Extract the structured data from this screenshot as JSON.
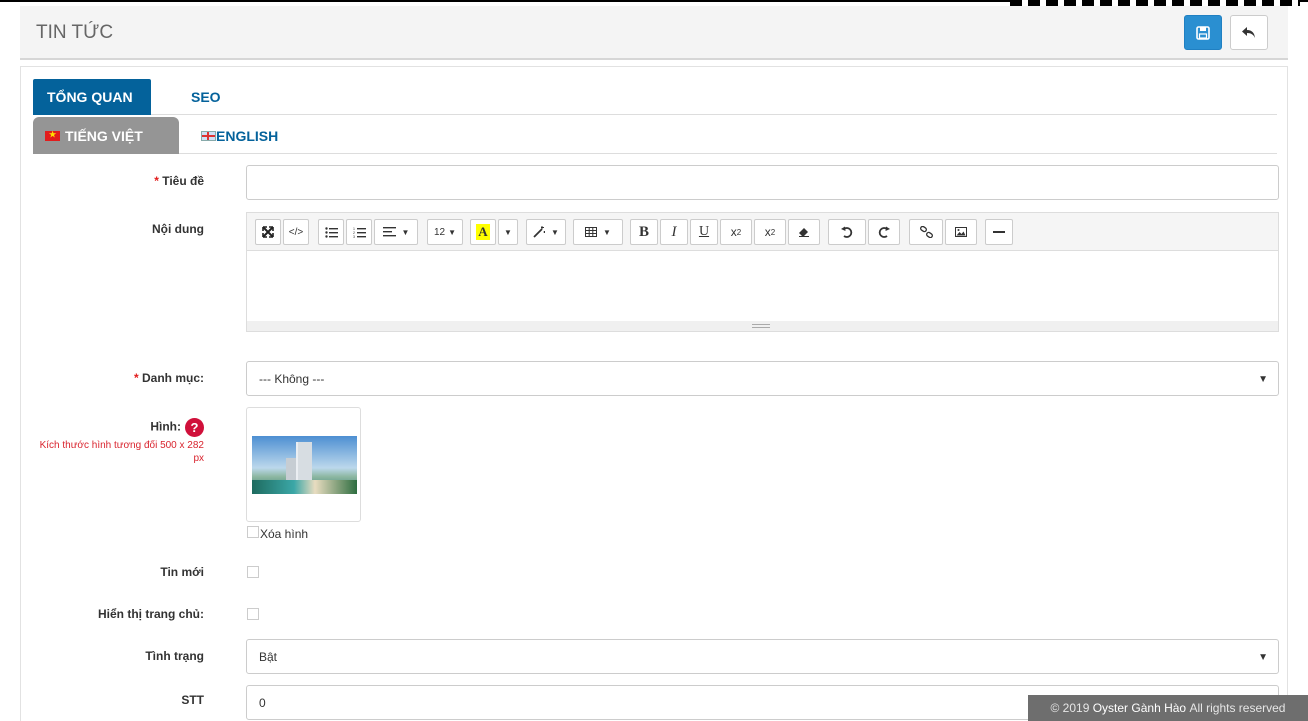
{
  "header": {
    "title": "TIN TỨC"
  },
  "tabs": [
    {
      "label": "TỔNG QUAN",
      "active": true
    },
    {
      "label": "SEO",
      "active": false
    }
  ],
  "lang_tabs": [
    {
      "label": "TIẾNG VIỆT",
      "flag": "vietnam-flag-icon",
      "active": true
    },
    {
      "label": "ENGLISH",
      "flag": "uk-flag-icon",
      "active": false
    }
  ],
  "form": {
    "title_label": "Tiêu đề",
    "title_value": "",
    "content_label": "Nội dung",
    "category_label": "Danh mục:",
    "category_value": "--- Không ---",
    "image_label": "Hình:",
    "image_hint": "Kích thước hình tương đối 500 x 282 px",
    "delete_image_label": "Xóa hình",
    "news_label": "Tin mới",
    "homepage_label": "Hiển thị trang chủ:",
    "status_label": "Tình trạng",
    "status_value": "Bật",
    "order_label": "STT",
    "order_value": "0",
    "required_mark": "*",
    "help_mark": "?"
  },
  "toolbar": {
    "font_size": "12",
    "items": [
      "fullscreen-icon",
      "code-view-icon",
      "unordered-list-icon",
      "ordered-list-icon",
      "align-icon",
      "font-size-select",
      "text-color-icon",
      "color-dropdown-icon",
      "magic-style-icon",
      "table-icon",
      "bold-icon",
      "italic-icon",
      "underline-icon",
      "superscript-icon",
      "subscript-icon",
      "eraser-icon",
      "undo-icon",
      "redo-icon",
      "link-icon",
      "picture-icon",
      "horizontal-rule-icon"
    ]
  },
  "footer": {
    "prefix": "© 2019 ",
    "brand": "Oyster Gành Hào",
    "suffix": " All rights reserved"
  },
  "colors": {
    "primary": "#04629b",
    "save": "#2a8fd1",
    "required": "#e21c1c",
    "footer_bg": "#6e6e6e"
  }
}
